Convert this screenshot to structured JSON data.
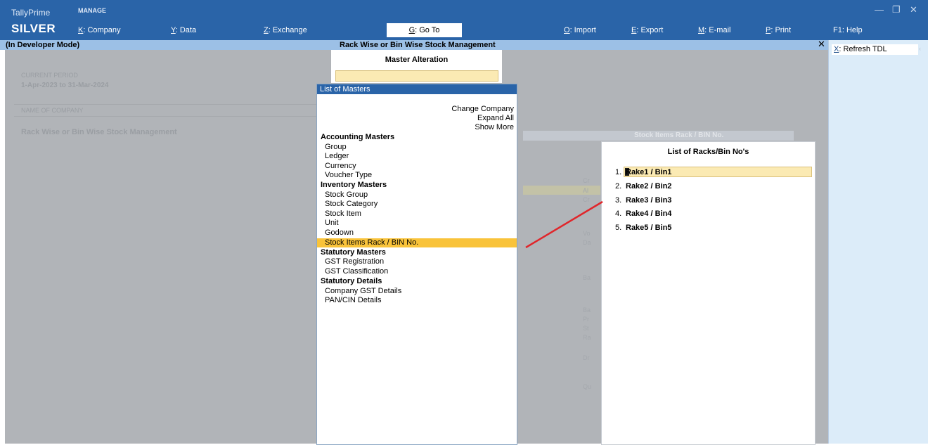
{
  "app": {
    "product": "TallyPrime",
    "edition": "SILVER",
    "manage_label": "MANAGE",
    "menu": [
      {
        "key": "K",
        "label": ": Company"
      },
      {
        "key": "Y",
        "label": ": Data"
      },
      {
        "key": "Z",
        "label": ": Exchange"
      },
      {
        "key": "G",
        "label": ": Go To"
      },
      {
        "key": "O",
        "label": ": Import"
      },
      {
        "key": "E",
        "label": ": Export"
      },
      {
        "key": "M",
        "label": ": E-mail"
      },
      {
        "key": "P",
        "label": ": Print"
      },
      {
        "key": "F1",
        "label": ": Help"
      }
    ],
    "window_controls": {
      "minimize": "—",
      "restore": "❐",
      "close": "✕"
    }
  },
  "titlebar": {
    "mode": "(In Developer Mode)",
    "title": "Rack Wise or Bin Wise Stock Management",
    "close": "✕"
  },
  "right_panel": {
    "refresh_key": "X",
    "refresh_label": ": Refresh TDL",
    "scroll_hint": "‹"
  },
  "company_info": {
    "current_period_label": "CURRENT PERIOD",
    "current_period": "1-Apr-2023 to 31-Mar-2024",
    "name_label": "NAME OF COMPANY",
    "company_name": "Rack Wise or Bin Wise Stock Management"
  },
  "master_alteration": {
    "title": "Master Alteration",
    "input_value": ""
  },
  "list_of_masters": {
    "title": "List of Masters",
    "actions": [
      "Change Company",
      "Expand All",
      "Show More"
    ],
    "groups": [
      {
        "name": "Accounting Masters",
        "items": [
          "Group",
          "Ledger",
          "Currency",
          "Voucher Type"
        ]
      },
      {
        "name": "Inventory Masters",
        "items": [
          "Stock Group",
          "Stock Category",
          "Stock Item",
          "Unit",
          "Godown",
          "Stock Items Rack / BIN No."
        ]
      },
      {
        "name": "Statutory Masters",
        "items": [
          "GST Registration",
          "GST Classification"
        ]
      },
      {
        "name": "Statutory Details",
        "items": [
          "Company GST Details",
          "PAN/CIN Details"
        ]
      }
    ],
    "selected": "Stock Items Rack / BIN No."
  },
  "background_form": {
    "header": "Stock Items Rack / BIN No.",
    "stubs": [
      "Cr",
      "Al",
      "Cr",
      "Vo",
      "Da",
      "Ba",
      "Ba",
      "Pr",
      "St",
      "Ra",
      "Dr",
      "Qu"
    ]
  },
  "racks_popup": {
    "title": "List of Racks/Bin No's",
    "items": [
      {
        "num": "1.",
        "label": "Rake1 / Bin1"
      },
      {
        "num": "2.",
        "label": "Rake2 / Bin2"
      },
      {
        "num": "3.",
        "label": "Rake3 / Bin3"
      },
      {
        "num": "4.",
        "label": "Rake4 / Bin4"
      },
      {
        "num": "5.",
        "label": "Rake5 / Bin5"
      }
    ],
    "selected_index": 0
  },
  "colors": {
    "topbar": "#2a64a8",
    "highlight": "#f9c33a",
    "selection": "#fbeab3",
    "arrow": "#e0262b"
  }
}
